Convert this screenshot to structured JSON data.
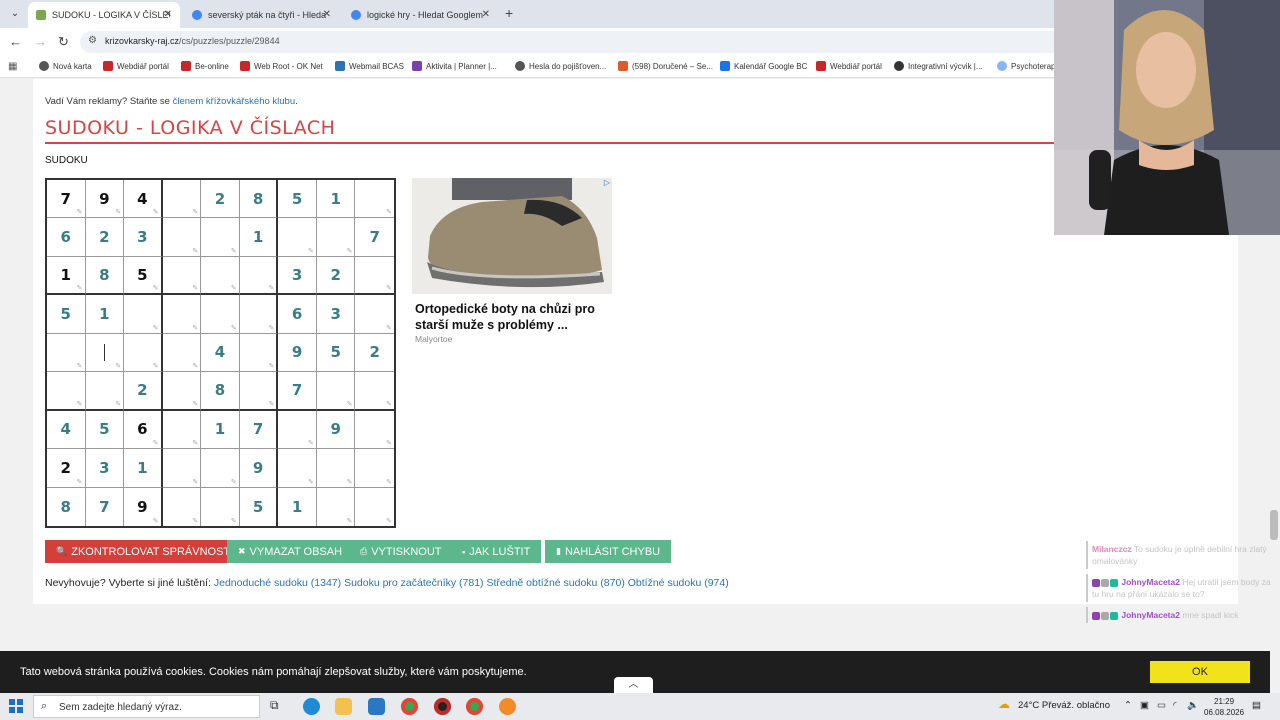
{
  "browser": {
    "tabs": [
      {
        "label": "SUDOKU - LOGIKA V ČÍSLECH | Křížovkářský ráj",
        "active": true,
        "favicon_color": "#7aa84a"
      },
      {
        "label": "severský pták na čtyři - Hledat Googlem",
        "active": false,
        "favicon_color": "#4285f4"
      },
      {
        "label": "logické hry - Hledat Googlem",
        "active": false,
        "favicon_color": "#4285f4"
      }
    ],
    "new_tab": "+",
    "url_domain": "krizovkarsky-raj.cz",
    "url_path": "/cs/puzzles/puzzle/29844",
    "bookmarks": [
      {
        "label": "Nová karta",
        "color": "#555555"
      },
      {
        "label": "Webdiář portál",
        "color": "#c62828"
      },
      {
        "label": "Be-online",
        "color": "#c62828"
      },
      {
        "label": "Web Root - OK Net",
        "color": "#c62828"
      },
      {
        "label": "Webmail BCAS",
        "color": "#2a73b8"
      },
      {
        "label": "Aktivita | Planner |...",
        "color": "#7b3fb0"
      },
      {
        "label": "Hesla do pojišťoven...",
        "color": "#555555"
      },
      {
        "label": "(598) Doručené – Se...",
        "color": "#e0592a"
      },
      {
        "label": "Kalendář Google BC",
        "color": "#1a73e8"
      },
      {
        "label": "Webdiář portál",
        "color": "#c62828"
      },
      {
        "label": "Integrativní výcvik |...",
        "color": "#333333"
      },
      {
        "label": "Psychoterap",
        "color": "#8ab4f8"
      }
    ]
  },
  "page": {
    "ad_note_prefix": "Vadí Vám reklamy? Staňte se ",
    "ad_note_link": "členem křížovkářského klubu",
    "ad_note_suffix": ".",
    "title": "SUDOKU - LOGIKA V ČÍSLACH",
    "subtitle": "SUDOKU",
    "sudoku": [
      [
        {
          "v": "7",
          "t": "user"
        },
        {
          "v": "9",
          "t": "user"
        },
        {
          "v": "4",
          "t": "user"
        },
        {
          "v": "",
          "t": "empty"
        },
        {
          "v": "2",
          "t": "given"
        },
        {
          "v": "8",
          "t": "given"
        },
        {
          "v": "5",
          "t": "given"
        },
        {
          "v": "1",
          "t": "given"
        },
        {
          "v": "",
          "t": "empty"
        }
      ],
      [
        {
          "v": "6",
          "t": "given"
        },
        {
          "v": "2",
          "t": "given"
        },
        {
          "v": "3",
          "t": "given"
        },
        {
          "v": "",
          "t": "empty"
        },
        {
          "v": "",
          "t": "empty"
        },
        {
          "v": "1",
          "t": "given"
        },
        {
          "v": "",
          "t": "empty"
        },
        {
          "v": "",
          "t": "empty"
        },
        {
          "v": "7",
          "t": "given"
        }
      ],
      [
        {
          "v": "1",
          "t": "user"
        },
        {
          "v": "8",
          "t": "given"
        },
        {
          "v": "5",
          "t": "user"
        },
        {
          "v": "",
          "t": "empty"
        },
        {
          "v": "",
          "t": "empty"
        },
        {
          "v": "",
          "t": "empty"
        },
        {
          "v": "3",
          "t": "given"
        },
        {
          "v": "2",
          "t": "given"
        },
        {
          "v": "",
          "t": "empty"
        }
      ],
      [
        {
          "v": "5",
          "t": "given"
        },
        {
          "v": "1",
          "t": "given"
        },
        {
          "v": "",
          "t": "empty"
        },
        {
          "v": "",
          "t": "empty"
        },
        {
          "v": "",
          "t": "empty"
        },
        {
          "v": "",
          "t": "empty"
        },
        {
          "v": "6",
          "t": "given"
        },
        {
          "v": "3",
          "t": "given"
        },
        {
          "v": "",
          "t": "empty"
        }
      ],
      [
        {
          "v": "",
          "t": "empty"
        },
        {
          "v": "",
          "t": "caret"
        },
        {
          "v": "",
          "t": "empty"
        },
        {
          "v": "",
          "t": "empty"
        },
        {
          "v": "4",
          "t": "given"
        },
        {
          "v": "",
          "t": "empty"
        },
        {
          "v": "9",
          "t": "given"
        },
        {
          "v": "5",
          "t": "given"
        },
        {
          "v": "2",
          "t": "given"
        }
      ],
      [
        {
          "v": "",
          "t": "empty"
        },
        {
          "v": "",
          "t": "empty"
        },
        {
          "v": "2",
          "t": "given"
        },
        {
          "v": "",
          "t": "empty"
        },
        {
          "v": "8",
          "t": "given"
        },
        {
          "v": "",
          "t": "empty"
        },
        {
          "v": "7",
          "t": "given"
        },
        {
          "v": "",
          "t": "empty"
        },
        {
          "v": "",
          "t": "empty"
        }
      ],
      [
        {
          "v": "4",
          "t": "given"
        },
        {
          "v": "5",
          "t": "given"
        },
        {
          "v": "6",
          "t": "user"
        },
        {
          "v": "",
          "t": "empty"
        },
        {
          "v": "1",
          "t": "given"
        },
        {
          "v": "7",
          "t": "given"
        },
        {
          "v": "",
          "t": "empty"
        },
        {
          "v": "9",
          "t": "given"
        },
        {
          "v": "",
          "t": "empty"
        }
      ],
      [
        {
          "v": "2",
          "t": "user"
        },
        {
          "v": "3",
          "t": "given"
        },
        {
          "v": "1",
          "t": "given"
        },
        {
          "v": "",
          "t": "empty"
        },
        {
          "v": "",
          "t": "empty"
        },
        {
          "v": "9",
          "t": "given"
        },
        {
          "v": "",
          "t": "empty"
        },
        {
          "v": "",
          "t": "empty"
        },
        {
          "v": "",
          "t": "empty"
        }
      ],
      [
        {
          "v": "8",
          "t": "given"
        },
        {
          "v": "7",
          "t": "given"
        },
        {
          "v": "9",
          "t": "user"
        },
        {
          "v": "",
          "t": "empty"
        },
        {
          "v": "",
          "t": "empty"
        },
        {
          "v": "5",
          "t": "given"
        },
        {
          "v": "1",
          "t": "given"
        },
        {
          "v": "",
          "t": "empty"
        },
        {
          "v": "",
          "t": "empty"
        }
      ]
    ],
    "ad": {
      "headline": "Ortopedické boty na chůzi pro starší muže s problémy ...",
      "brand": "Malyortoe"
    },
    "buttons": [
      {
        "label": "ZKONTROLOVAT SPRÁVNOST",
        "icon": "search-icon",
        "glyph": "🔍",
        "style": "red"
      },
      {
        "label": "VYMAZAT OBSAH",
        "icon": "close-icon",
        "glyph": "✖",
        "style": "green"
      },
      {
        "label": "VYTISKNOUT",
        "icon": "print-icon",
        "glyph": "⎙",
        "style": "green"
      },
      {
        "label": "JAK LUŠTIT",
        "icon": "comment-icon",
        "glyph": "▪",
        "style": "green"
      },
      {
        "label": "NAHLÁSIT CHYBU",
        "icon": "trash-icon",
        "glyph": "▮",
        "style": "green"
      }
    ],
    "more_prefix": "Nevyhovuje? Vyberte si jiné luštění: ",
    "more_links": [
      "Jednoduché sudoku (1347)",
      "Sudoku pro začátečníky (781)",
      "Středně obtížné sudoku (870)",
      "Obtížné sudoku (974)"
    ]
  },
  "chat": [
    {
      "user": "Milanczcz",
      "text": "To sudoku je úplně debilní hra zlatý omalovánky"
    },
    {
      "user": "JohnyMaceta2",
      "text": "Hej utratil jsem body za tu hru na přání ukázalo se to?"
    },
    {
      "user": "JohnyMaceta2",
      "text": "mne spadl kick"
    }
  ],
  "cookie": {
    "text": "Tato webová stránka používá cookies. Cookies nám pomáhají zlepšovat služby, které vám poskytujeme.",
    "ok": "OK"
  },
  "taskbar": {
    "search_placeholder": "Sem zadejte hledaný výraz.",
    "weather": "24°C  Převáž. oblačno",
    "time": "21:29",
    "date": "06.08.2026"
  },
  "colors": {
    "title_red": "#d64545",
    "given_digit": "#3a7d84",
    "button_red": "#d43f3a",
    "button_green": "#5cb88c",
    "cookie_ok": "#f2e21a"
  }
}
